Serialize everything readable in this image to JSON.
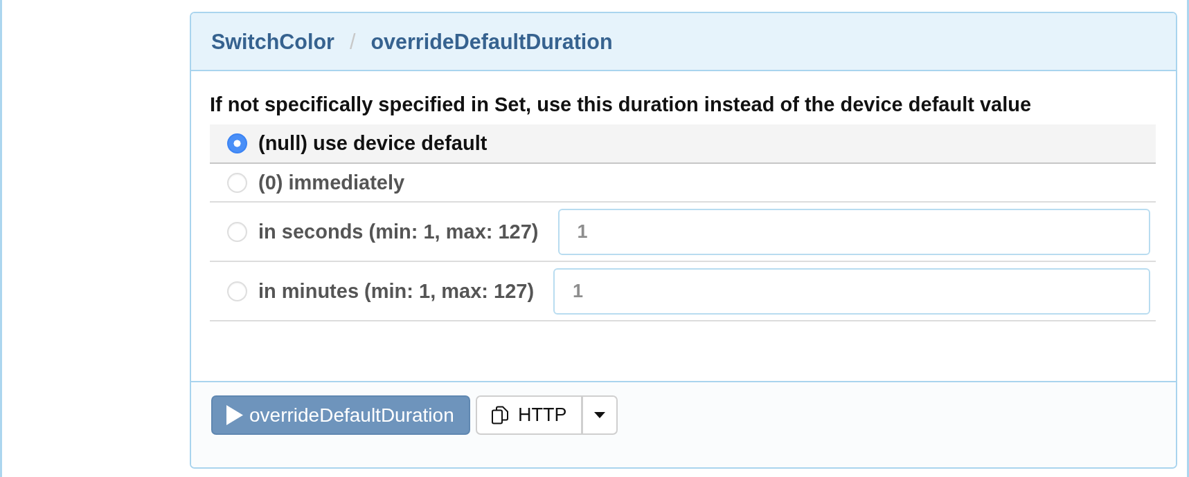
{
  "breadcrumb": {
    "items": [
      "SwitchColor",
      "overrideDefaultDuration"
    ],
    "separator": "/"
  },
  "description": "If not specifically specified in Set, use this duration instead of the device default value",
  "options": [
    {
      "label": "(null) use device default",
      "selected": true
    },
    {
      "label": "(0) immediately",
      "selected": false
    },
    {
      "label": "in seconds (min: 1, max: 127)",
      "selected": false,
      "input": {
        "placeholder": "1"
      }
    },
    {
      "label": "in minutes (min: 1, max: 127)",
      "selected": false,
      "input": {
        "placeholder": "1"
      }
    }
  ],
  "actions": [
    {
      "kind": "run",
      "label": "overrideDefaultDuration"
    },
    {
      "kind": "copy",
      "label": "HTTP",
      "split_menu": true
    }
  ]
}
